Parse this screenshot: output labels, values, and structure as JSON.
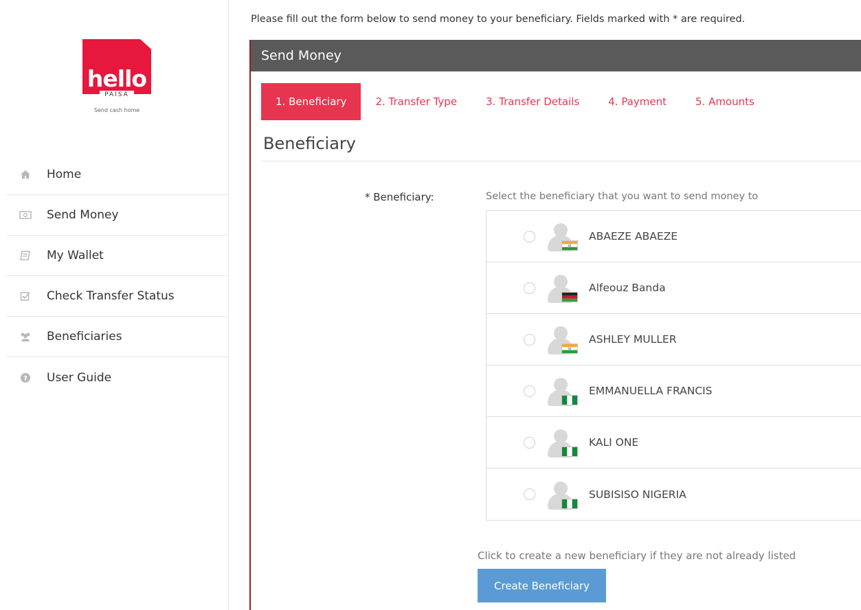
{
  "brand": {
    "word": "hello",
    "sub": "PAISA",
    "tagline": "Send cash home",
    "color": "#e8173d"
  },
  "sidebar": {
    "items": [
      {
        "label": "Home",
        "icon": "home-icon"
      },
      {
        "label": "Send Money",
        "icon": "money-icon"
      },
      {
        "label": "My Wallet",
        "icon": "wallet-icon"
      },
      {
        "label": "Check Transfer Status",
        "icon": "checkbox-icon"
      },
      {
        "label": "Beneficiaries",
        "icon": "users-icon"
      },
      {
        "label": "User Guide",
        "icon": "help-circle-icon"
      }
    ]
  },
  "intro": "Please fill out the form below to send money to your beneficiary. Fields marked with * are required.",
  "panel": {
    "title": "Send Money",
    "header_color": "#5a5a5a",
    "accent_color": "#e8354f"
  },
  "steps": [
    {
      "label": "1. Beneficiary",
      "active": true
    },
    {
      "label": "2. Transfer Type",
      "active": false
    },
    {
      "label": "3. Transfer Details",
      "active": false
    },
    {
      "label": "4. Payment",
      "active": false
    },
    {
      "label": "5. Amounts",
      "active": false
    }
  ],
  "section_title": "Beneficiary",
  "field": {
    "label": "* Beneficiary:",
    "help": "Select the beneficiary that you want to send money to"
  },
  "beneficiaries": [
    {
      "name": "ABAEZE ABAEZE",
      "flag": "india",
      "selected": false
    },
    {
      "name": "Alfeouz Banda",
      "flag": "malawi",
      "selected": false
    },
    {
      "name": "ASHLEY MULLER",
      "flag": "india",
      "selected": false
    },
    {
      "name": "EMMANUELLA FRANCIS",
      "flag": "nigeria",
      "selected": false
    },
    {
      "name": "KALI ONE",
      "flag": "nigeria",
      "selected": false
    },
    {
      "name": "SUBISISO NIGERIA",
      "flag": "nigeria",
      "selected": false
    }
  ],
  "create": {
    "help": "Click to create a new beneficiary if they are not already listed",
    "button_label": "Create Beneficiary",
    "button_color": "#5b9bd5"
  }
}
